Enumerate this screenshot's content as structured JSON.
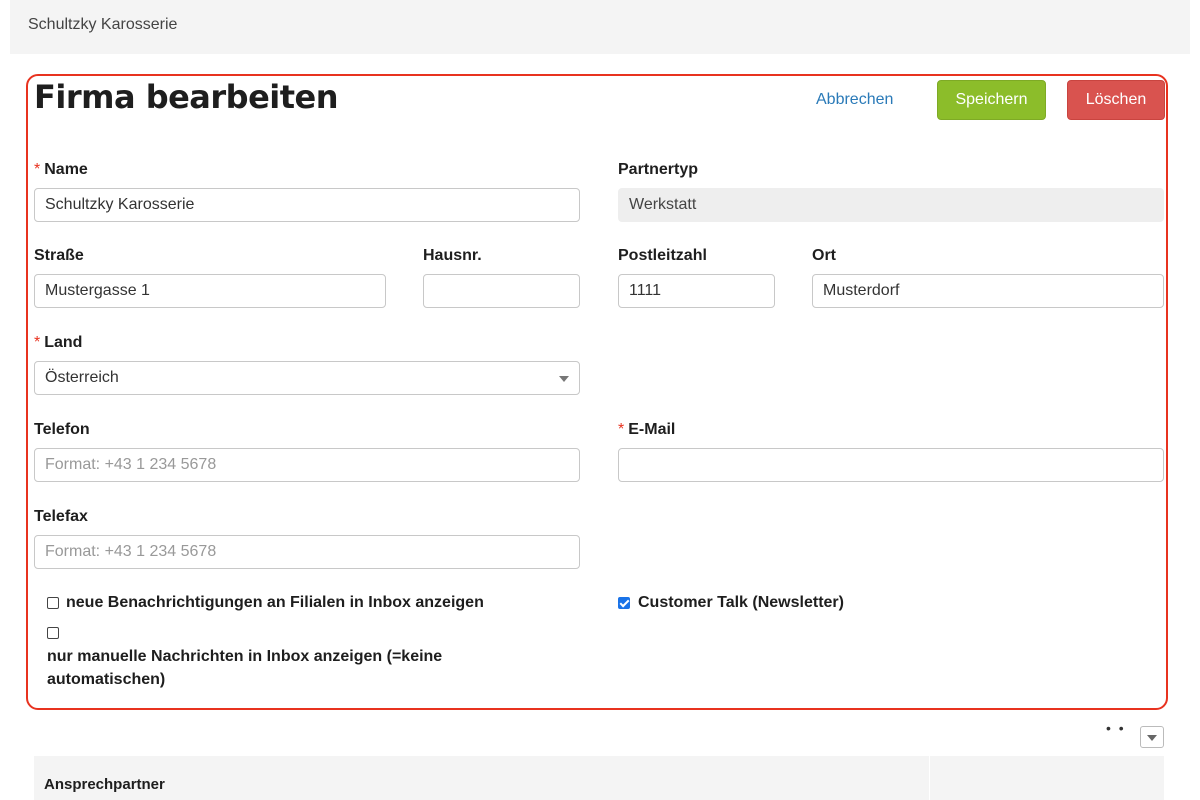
{
  "breadcrumb": "Schultzky Karosserie",
  "title": "Firma bearbeiten",
  "actions": {
    "cancel": "Abbrechen",
    "save": "Speichern",
    "delete": "Löschen"
  },
  "fields": {
    "name": {
      "label": "Name",
      "value": "Schultzky Karosserie",
      "required": true
    },
    "partnertyp": {
      "label": "Partnertyp",
      "value": "Werkstatt"
    },
    "strasse": {
      "label": "Straße",
      "value": "Mustergasse 1"
    },
    "hausnr": {
      "label": "Hausnr.",
      "value": ""
    },
    "plz": {
      "label": "Postleitzahl",
      "value": "1111"
    },
    "ort": {
      "label": "Ort",
      "value": "Musterdorf"
    },
    "land": {
      "label": "Land",
      "value": "Österreich",
      "required": true
    },
    "telefon": {
      "label": "Telefon",
      "placeholder": "Format: +43 1 234 5678"
    },
    "email": {
      "label": "E-Mail",
      "value": "",
      "required": true
    },
    "telefax": {
      "label": "Telefax",
      "placeholder": "Format: +43 1 234 5678"
    }
  },
  "checkboxes": {
    "benachrichtigungen": {
      "label": "neue Benachrichtigungen an Filialen in Inbox anzeigen",
      "checked": false
    },
    "manuelle": {
      "label": "nur manuelle Nachrichten in Inbox anzeigen (=keine automatischen)",
      "checked": false
    },
    "newsletter": {
      "label": "Customer Talk (Newsletter)",
      "checked": true
    }
  },
  "table": {
    "header": "Ansprechpartner"
  },
  "colors": {
    "accent_border": "#e8321f",
    "save": "#8cbd2a",
    "delete": "#d9534f",
    "link": "#2a7ab8"
  }
}
